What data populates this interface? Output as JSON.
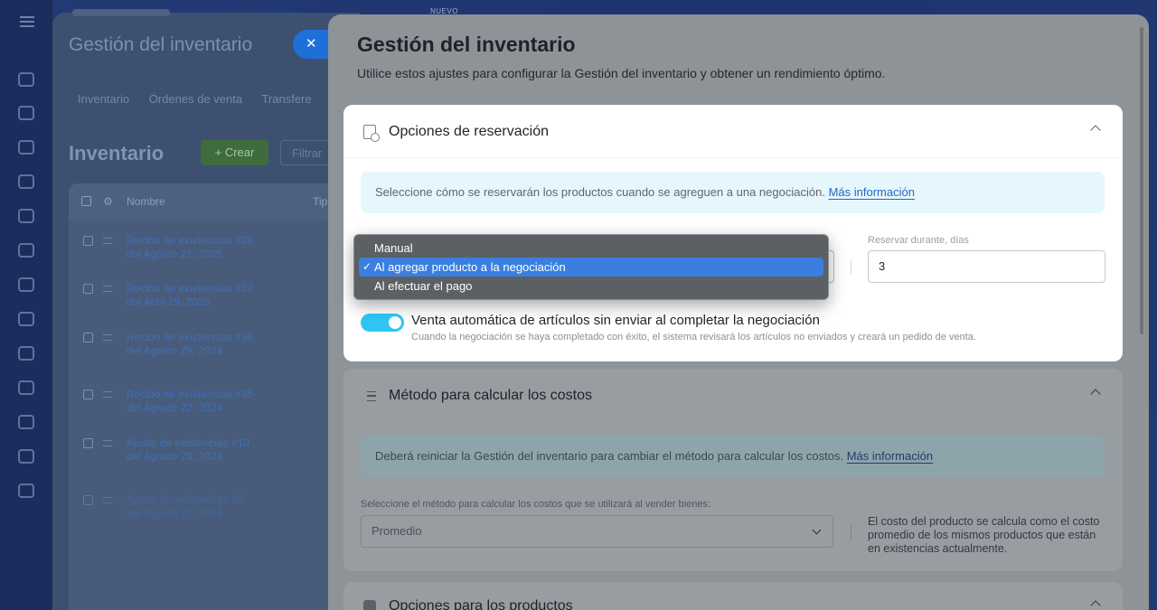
{
  "background": {
    "nuevo_label": "NUEVO",
    "title": "Gestión del inventario",
    "close_glyph": "✕",
    "tabs": [
      "Inventario",
      "Órdenes de venta",
      "Transfere"
    ],
    "section_title": "Inventario",
    "create_label": "+ Crear",
    "filter_label": "Filtrar",
    "table": {
      "header_name": "Nombre",
      "header_type": "Tip",
      "rows": [
        {
          "line1": "Recibo de existencias #38",
          "line2": "del Agosto 21, 2025"
        },
        {
          "line1": "Recibo de existencias #37",
          "line2": "del Abril 29, 2025"
        },
        {
          "line1": "Recibo de existencias #36",
          "line2": "del Agosto 29, 2024"
        },
        {
          "line1": "Recibo de existencias #35",
          "line2": "del Agosto 22, 2024"
        },
        {
          "line1": "Ajuste de existencias #10",
          "line2": "del Agosto 23, 2024"
        },
        {
          "line1": "Ajuste de existencias #9",
          "line2": "del Agosto 22, 2024"
        }
      ]
    }
  },
  "settings": {
    "title": "Gestión del inventario",
    "description": "Utilice estos ajustes para configurar la Gestión del inventario y obtener un rendimiento óptimo.",
    "reservation": {
      "title": "Opciones de reservación",
      "info_text": "Seleccione cómo se reservarán los productos cuando se agreguen a una negociación.",
      "info_link": "Más información",
      "days_label": "Reservar durante, días",
      "days_value": "3",
      "toggle_on": true,
      "toggle_label": "Venta automática de artículos sin enviar al completar la negociación",
      "toggle_hint": "Cuando la negociación se haya completado con éxito, el sistema revisará los artículos no enviados y creará un pedido de venta.",
      "dropdown": {
        "options": [
          "Manual",
          "Al agregar producto a la negociación",
          "Al efectuar el pago"
        ],
        "selected": "Al agregar producto a la negociación",
        "check_glyph": "✓"
      }
    },
    "cost_method": {
      "title": "Método para calcular los costos",
      "info_text": "Deberá reiniciar la Gestión del inventario para cambiar el método para calcular los costos.",
      "info_link": "Más información",
      "select_label": "Seleccione el método para calcular los costos que se utilizará al vender bienes:",
      "select_value": "Promedio",
      "note": "El costo del producto se calcula como el costo promedio de los mismos productos que están en existencias actualmente."
    },
    "products": {
      "title": "Opciones para los productos"
    }
  }
}
